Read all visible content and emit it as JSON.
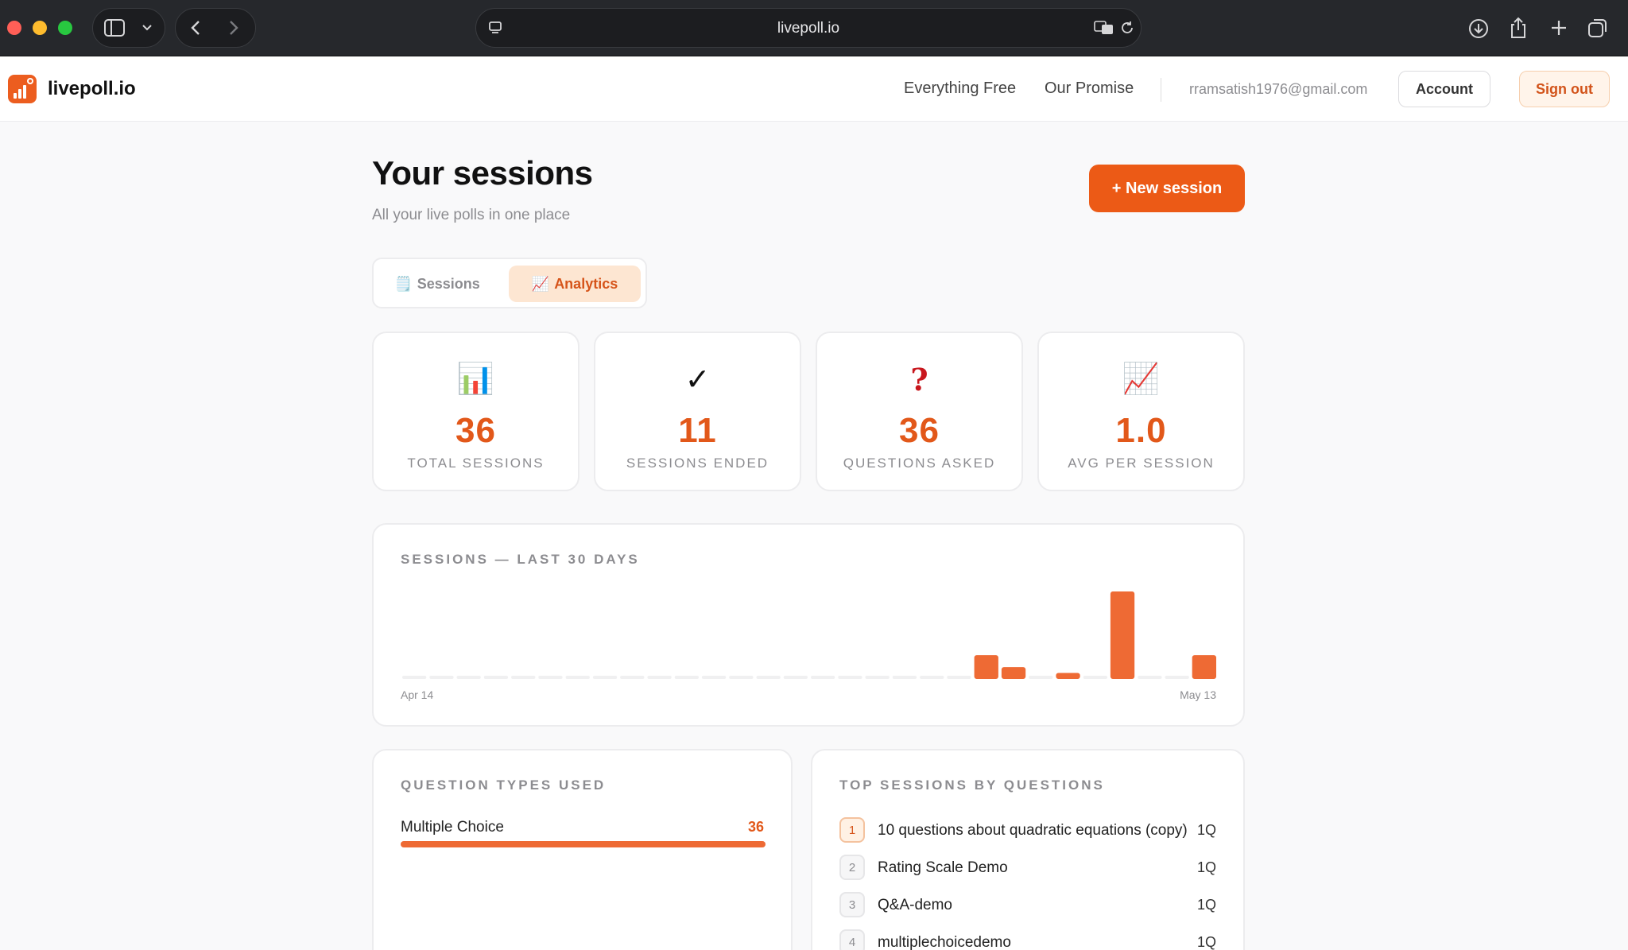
{
  "browser": {
    "url": "livepoll.io",
    "colors": {
      "close": "#ff5f57",
      "minimize": "#febc2e",
      "maximize": "#28c840"
    }
  },
  "header": {
    "brand": "livepoll.io",
    "nav": [
      "Everything Free",
      "Our Promise"
    ],
    "user_email": "rramsatish1976@gmail.com",
    "account_label": "Account",
    "signout_label": "Sign out"
  },
  "main": {
    "title": "Your sessions",
    "subtitle": "All your live polls in one place",
    "new_session_label": "+ New session",
    "tabs": [
      {
        "icon": "🗒️",
        "label": "Sessions",
        "active": false
      },
      {
        "icon": "📈",
        "label": "Analytics",
        "active": true
      }
    ],
    "stats": [
      {
        "icon": "📊",
        "value": "36",
        "label": "TOTAL SESSIONS"
      },
      {
        "icon": "✓",
        "value": "11",
        "label": "SESSIONS ENDED"
      },
      {
        "icon": "?",
        "value": "36",
        "label": "QUESTIONS ASKED"
      },
      {
        "icon": "📈",
        "value": "1.0",
        "label": "AVG PER SESSION"
      }
    ]
  },
  "chart_data": {
    "type": "bar",
    "title": "SESSIONS — LAST 30 DAYS",
    "x_start_label": "Apr 14",
    "x_end_label": "May 13",
    "values": [
      0,
      0,
      0,
      0,
      0,
      0,
      0,
      0,
      0,
      0,
      0,
      0,
      0,
      0,
      0,
      0,
      0,
      0,
      0,
      0,
      0,
      4,
      2,
      0,
      1,
      0,
      15,
      0,
      0,
      4
    ],
    "bar_color": "#ee6a34",
    "empty_color": "#f0f0f1"
  },
  "question_types": {
    "title": "QUESTION TYPES USED",
    "items": [
      {
        "name": "Multiple Choice",
        "count": 36,
        "fraction": 1.0
      }
    ]
  },
  "top_sessions": {
    "title": "TOP SESSIONS BY QUESTIONS",
    "items": [
      {
        "rank": "1",
        "name": "10 questions about quadratic equations (copy)",
        "count": "1Q"
      },
      {
        "rank": "2",
        "name": "Rating Scale Demo",
        "count": "1Q"
      },
      {
        "rank": "3",
        "name": "Q&A-demo",
        "count": "1Q"
      },
      {
        "rank": "4",
        "name": "multiplechoicedemo",
        "count": "1Q"
      }
    ]
  }
}
